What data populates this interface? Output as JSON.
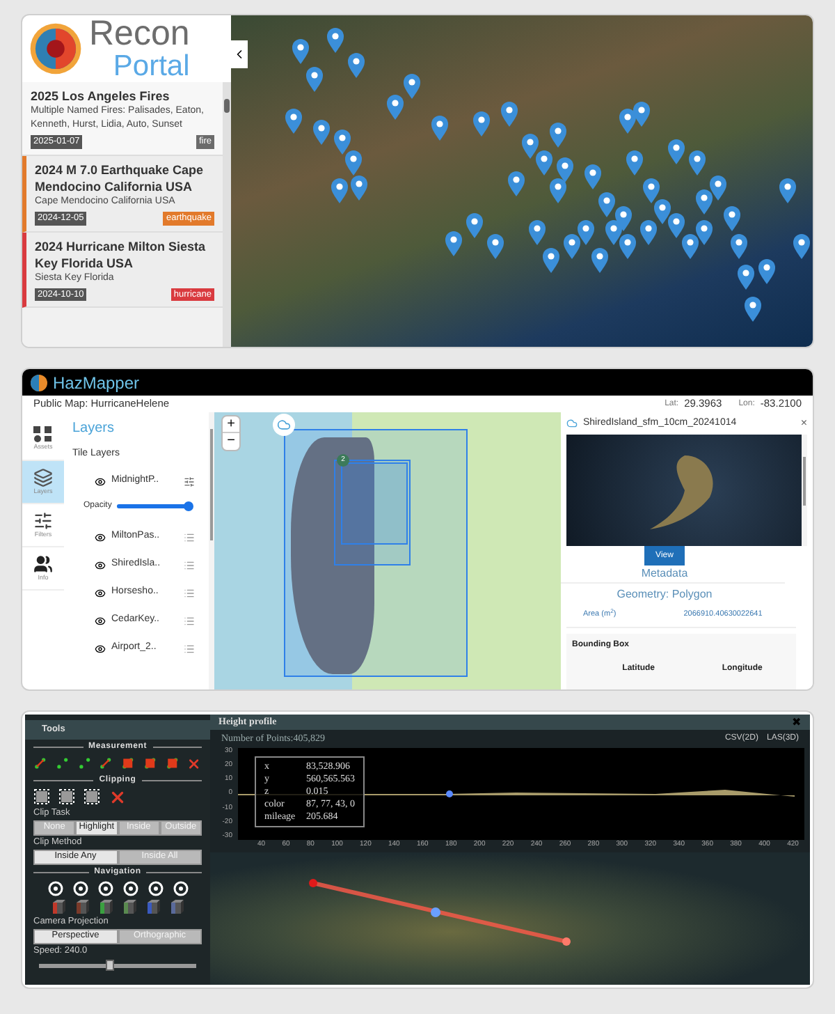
{
  "recon": {
    "logo_line1": "Recon",
    "logo_line2": "Portal",
    "events": [
      {
        "title": "2025 Los Angeles Fires",
        "subtitle": "Multiple Named Fires: Palisades, Eaton, Kenneth, Hurst, Lidia, Auto, Sunset",
        "date": "2025-01-07",
        "tag": "fire",
        "color": "#6b6b6b",
        "selected": true
      },
      {
        "title": "2024 M 7.0 Earthquake Cape Mendocino California USA",
        "subtitle": "Cape Mendocino California USA",
        "date": "2024-12-05",
        "tag": "earthquake",
        "color": "#e27a2b",
        "selected": false
      },
      {
        "title": "2024 Hurricane Milton Siesta Key Florida USA",
        "subtitle": "Siesta Key Florida",
        "date": "2024-10-10",
        "tag": "hurricane",
        "color": "#d93a3f",
        "selected": false
      }
    ]
  },
  "hazmapper": {
    "app_title": "HazMapper",
    "map_name": "Public Map: HurricaneHelene",
    "lat_label": "Lat:",
    "lat": "29.3963",
    "lon_label": "Lon:",
    "lon": "-83.2100",
    "nav": [
      {
        "label": "Assets",
        "selected": false
      },
      {
        "label": "Layers",
        "selected": true
      },
      {
        "label": "Filters",
        "selected": false
      },
      {
        "label": "Info",
        "selected": false
      }
    ],
    "layers_title": "Layers",
    "section": "Tile Layers",
    "layers": [
      {
        "name": "MidnightP..",
        "expanded": true,
        "opacity_label": "Opacity",
        "level": 1
      },
      {
        "name": "MiltonPas..",
        "expanded": false
      },
      {
        "name": "ShiredIsla..",
        "expanded": false
      },
      {
        "name": "Horsesho..",
        "expanded": false
      },
      {
        "name": "CedarKey..",
        "expanded": false
      },
      {
        "name": "Airport_2..",
        "expanded": false
      }
    ],
    "zoom_in": "+",
    "zoom_out": "−",
    "cluster_count": "2",
    "detail": {
      "title": "ShiredIsland_sfm_10cm_20241014",
      "close": "×",
      "view_button": "View",
      "metadata": "Metadata",
      "geometry": "Geometry: Polygon",
      "rows": [
        {
          "key": "Area (m$^{2}$)",
          "value": "2066910.40630022641"
        }
      ],
      "bbox_title": "Bounding Box",
      "bbox_columns": [
        "Latitude",
        "Longitude"
      ]
    }
  },
  "potree": {
    "tools_title": "Tools",
    "measurement": "Measurement",
    "clipping": "Clipping",
    "clip_task_label": "Clip Task",
    "clip_task": [
      {
        "label": "None",
        "selected": false
      },
      {
        "label": "Highlight",
        "selected": true
      },
      {
        "label": "Inside",
        "selected": false
      },
      {
        "label": "Outside",
        "selected": false
      }
    ],
    "clip_method_label": "Clip Method",
    "clip_method": [
      {
        "label": "Inside Any",
        "selected": true
      },
      {
        "label": "Inside All",
        "selected": false
      }
    ],
    "navigation": "Navigation",
    "projection_label": "Camera Projection",
    "projection": [
      {
        "label": "Perspective",
        "selected": true
      },
      {
        "label": "Orthographic",
        "selected": false
      }
    ],
    "speed_label": "Speed: 240.0",
    "speed": {
      "level": 0.45
    },
    "profile": {
      "title": "Height profile",
      "close": "✖",
      "points": "Number of Points:405,829",
      "exports": [
        "CSV(2D)",
        "LAS(3D)"
      ],
      "yticks": [
        "30",
        "20",
        "10",
        "0",
        "-10",
        "-20",
        "-30"
      ],
      "xticks": [
        "40",
        "60",
        "80",
        "100",
        "120",
        "140",
        "160",
        "180",
        "200",
        "220",
        "240",
        "260",
        "280",
        "300",
        "320",
        "340",
        "360",
        "380",
        "400",
        "420"
      ],
      "tooltip": [
        {
          "key": "x",
          "value": "83,528.906"
        },
        {
          "key": "y",
          "value": "560,565.563"
        },
        {
          "key": "z",
          "value": "0.015"
        },
        {
          "key": "color",
          "value": "87, 77, 43, 0"
        },
        {
          "key": "mileage",
          "value": "205.684"
        }
      ]
    }
  }
}
